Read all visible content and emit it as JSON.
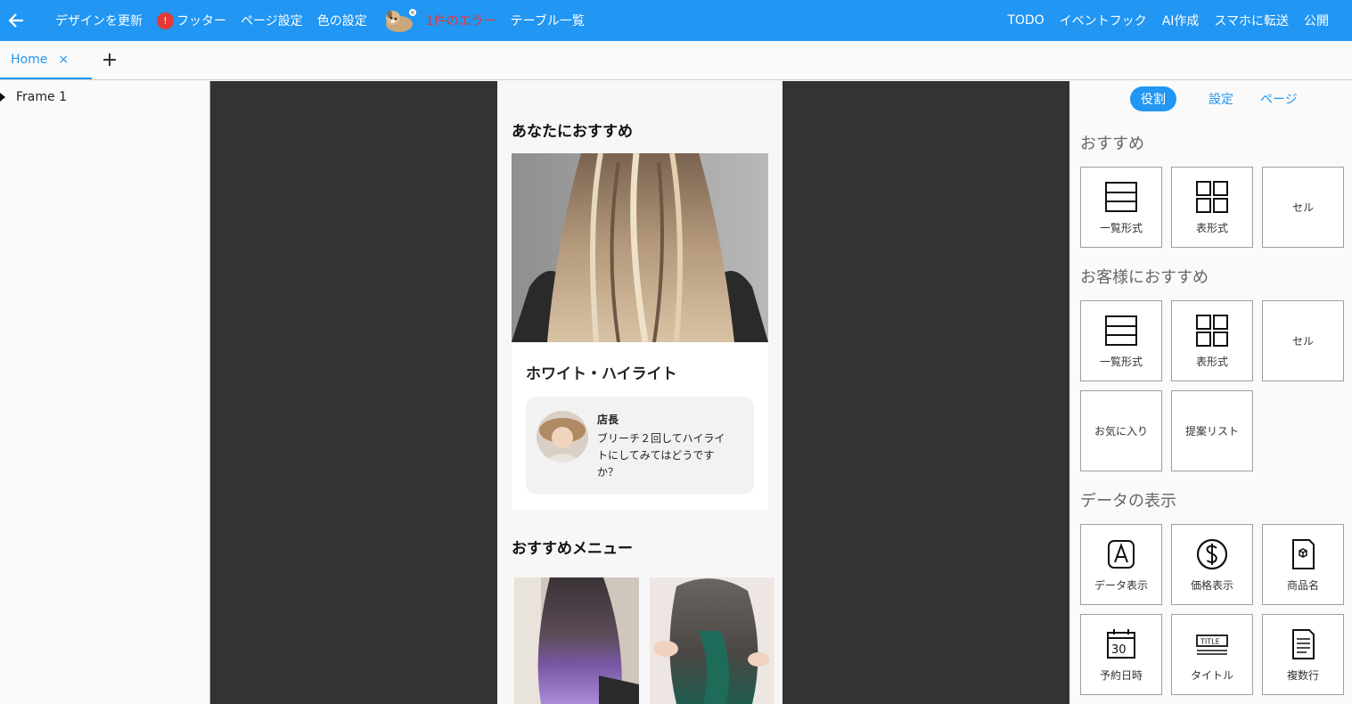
{
  "topbar": {
    "items": [
      "デザインを更新",
      "フッター",
      "ページ設定",
      "色の設定"
    ],
    "badge": "!",
    "error": "1件のエラー",
    "table_list": "テーブル一覧",
    "right_items": [
      "TODO",
      "イベントフック",
      "AI作成",
      "スマホに転送",
      "公開"
    ]
  },
  "tabbar": {
    "tab_label": "Home",
    "close": "×",
    "add": "+"
  },
  "tree": {
    "frame": "Frame 1"
  },
  "phone": {
    "section1": "あなたにおすすめ",
    "card_title": "ホワイト・ハイライト",
    "comment_name": "店長",
    "comment_text": "ブリーチ２回してハイライトにしてみてはどうですか？",
    "section2": "おすすめメニュー"
  },
  "rightpanel": {
    "tabs": [
      "役割",
      "設定",
      "ページ"
    ],
    "groups": [
      {
        "title": "おすすめ",
        "tiles": [
          "一覧形式",
          "表形式",
          "セル"
        ]
      },
      {
        "title": "お客様におすすめ",
        "tiles": [
          "一覧形式",
          "表形式",
          "セル",
          "お気に入り",
          "提案リスト"
        ]
      },
      {
        "title": "データの表示",
        "tiles": [
          "データ表示",
          "価格表示",
          "商品名",
          "予約日時",
          "タイトル",
          "複数行"
        ]
      }
    ]
  },
  "colors": {
    "primary": "#2196f3",
    "canvas": "#333333",
    "error": "#e53935"
  }
}
